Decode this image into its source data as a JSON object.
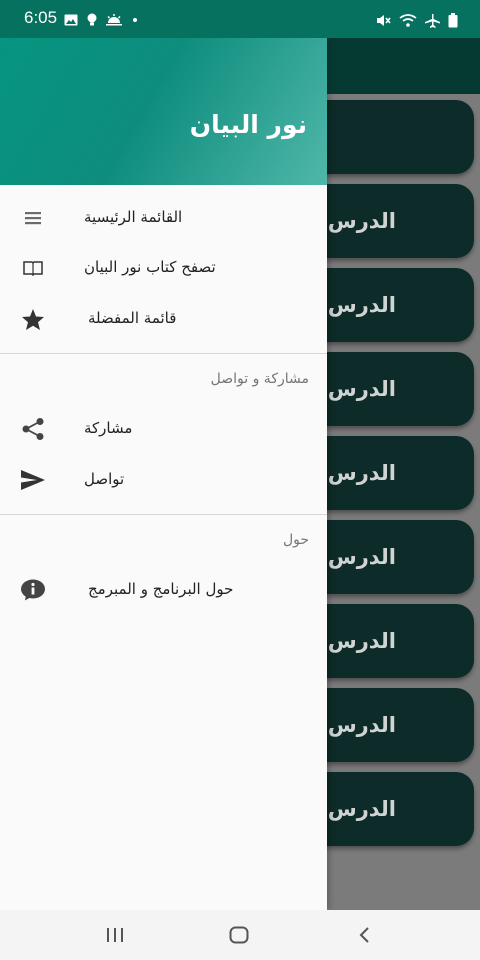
{
  "status_bar": {
    "time": "6:05",
    "left_icons": [
      "gallery-icon",
      "bulb-icon",
      "weather-icon",
      "dot-icon"
    ],
    "right_icons": [
      "mute-icon",
      "wifi-icon",
      "airplane-icon",
      "battery-icon"
    ],
    "bg_color": "#07715f"
  },
  "drawer": {
    "title": "نور البيان",
    "header_gradient": [
      "#069580",
      "#4fb7aa"
    ],
    "main_items": [
      {
        "label": "القائمة الرئيسية",
        "icon": "menu-icon"
      },
      {
        "label": "تصفح كتاب نور البيان",
        "icon": "book-icon"
      },
      {
        "label": "قائمة المفضلة",
        "icon": "star-icon"
      }
    ],
    "share_section": {
      "title": "مشاركة و تواصل",
      "items": [
        {
          "label": "مشاركة",
          "icon": "share-icon"
        },
        {
          "label": "تواصل",
          "icon": "send-icon"
        }
      ]
    },
    "about_section": {
      "title": "حول",
      "items": [
        {
          "label": "حول البرنامج و المبرمج",
          "icon": "info-icon"
        }
      ]
    }
  },
  "background_list": {
    "card_color": "#0d2b28",
    "cards": [
      "",
      "الدرس",
      "الدرس",
      "الدرس",
      "الدرس",
      "الدرس",
      "الدرس",
      "الدرس الس",
      "الدرس"
    ]
  },
  "nav_bar": {
    "buttons": [
      "recents-icon",
      "home-icon",
      "back-icon"
    ]
  }
}
